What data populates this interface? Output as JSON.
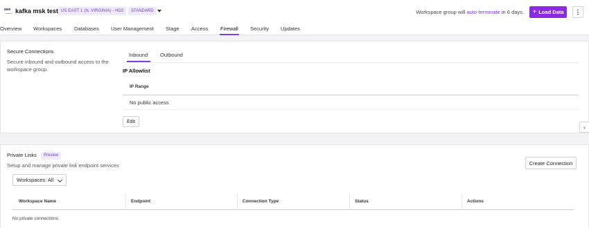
{
  "header": {
    "logo_text": "aws",
    "workspace_name": "kafka msk test",
    "region": "US EAST 1 (N. VIRGINIA) - HD2",
    "edition": "STANDARD",
    "status_prefix": "Workspace group will",
    "status_link": "auto-terminate",
    "status_suffix": "in 6 days.",
    "load_data_label": "Load Data"
  },
  "tabs": [
    {
      "label": "Overview"
    },
    {
      "label": "Workspaces"
    },
    {
      "label": "Databases"
    },
    {
      "label": "User Management"
    },
    {
      "label": "Stage"
    },
    {
      "label": "Access"
    },
    {
      "label": "Firewall",
      "active": true
    },
    {
      "label": "Security"
    },
    {
      "label": "Updates"
    }
  ],
  "secure_connections": {
    "title": "Secure Connections",
    "description": "Secure inbound and outbound access to the workspace group.",
    "subtabs": [
      {
        "label": "Inbound",
        "active": true
      },
      {
        "label": "Outbound"
      }
    ],
    "allowlist_title": "IP Allowlist",
    "column_header": "IP Range",
    "rows": [
      "No public access"
    ],
    "edit_label": "Edit"
  },
  "private_links": {
    "title": "Private Links",
    "badge": "Preview",
    "description": "Setup and manage private link endpoint services",
    "create_label": "Create Connection",
    "filter_value": "Workspaces: All",
    "columns": [
      "Workspace Name",
      "Endpoint",
      "Connection Type",
      "Status",
      "Actions"
    ],
    "empty_message": "No private connections"
  },
  "colors": {
    "accent": "#7a3ee6",
    "primary_button": "#8a2be2"
  }
}
